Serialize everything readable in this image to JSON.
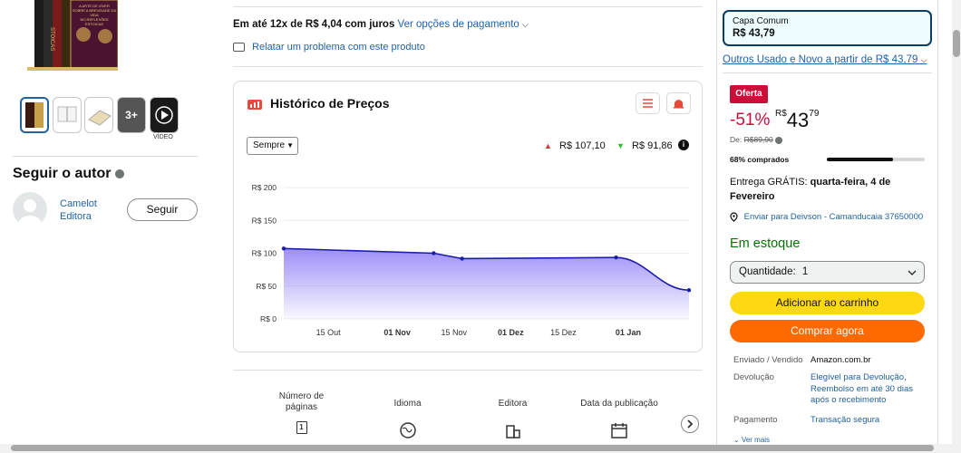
{
  "gallery": {
    "more_count": "3+",
    "video_label": "VÍDEO",
    "cover_lines": [
      "STOICAS",
      "A ARTE DE VIVER",
      "SOBRE A BREVIDADE DA VIDA",
      "NO REFLEXÕES ESTOICAS"
    ]
  },
  "author": {
    "section_title": "Seguir o autor",
    "name": "Camelot Editora",
    "follow_label": "Seguir"
  },
  "payment": {
    "installment": "Em até 12x de R$ 4,04 com juros",
    "options_link": "Ver opções de pagamento",
    "report_link": "Relatar um problema com este produto"
  },
  "price_history": {
    "title": "Histórico de Preços",
    "period_select": "Sempre",
    "max_price": "R$ 107,10",
    "min_price": "R$ 91,86",
    "accent": "#6b5cf0"
  },
  "chart_data": {
    "type": "area",
    "title": "",
    "xlabel": "",
    "ylabel": "",
    "ylim": [
      0,
      200
    ],
    "yticks": [
      "R$ 200",
      "R$ 150",
      "R$ 100",
      "R$ 50",
      "R$ 0"
    ],
    "ytick_values": [
      200,
      150,
      100,
      50,
      0
    ],
    "xticks": [
      {
        "label": "15 Out",
        "bold": false,
        "pos": 0.11
      },
      {
        "label": "01 Nov",
        "bold": true,
        "pos": 0.28
      },
      {
        "label": "15 Nov",
        "bold": false,
        "pos": 0.42
      },
      {
        "label": "01 Dez",
        "bold": true,
        "pos": 0.56
      },
      {
        "label": "15 Dez",
        "bold": false,
        "pos": 0.69
      },
      {
        "label": "01 Jan",
        "bold": true,
        "pos": 0.85
      }
    ],
    "series": [
      {
        "x": [
          0.0,
          0.37,
          0.44,
          0.82,
          1.0
        ],
        "values": [
          107.1,
          100.0,
          91.86,
          93.5,
          43.79
        ]
      }
    ],
    "grid": true
  },
  "details": {
    "items": [
      {
        "label": "Número de páginas",
        "icon": "pages-icon"
      },
      {
        "label": "Idioma",
        "icon": "globe-icon"
      },
      {
        "label": "Editora",
        "icon": "building-icon"
      },
      {
        "label": "Data da publicação",
        "icon": "calendar-icon"
      }
    ]
  },
  "buybox": {
    "format_name": "Capa Comum",
    "format_price": "R$ 43,79",
    "used_link": "Outros Usado e Novo a partir de R$ 43,79",
    "deal_badge": "Oferta",
    "discount": "-51%",
    "currency": "R$",
    "price_whole": "43",
    "price_fraction": "79",
    "list_price_label": "De:",
    "list_price": "R$89,90",
    "bought_pct_label": "68% comprados",
    "bought_pct": 68,
    "delivery_prefix": "Entrega GRÁTIS:",
    "delivery_date": "quarta-feira, 4 de Fevereiro",
    "ship_to": "Enviar para Deivson - Camanducaia 37650000",
    "stock": "Em estoque",
    "quantity_label": "Quantidade:",
    "quantity_value": "1",
    "add_to_cart": "Adicionar ao carrinho",
    "buy_now": "Comprar agora",
    "sold_by_label": "Enviado / Vendido",
    "sold_by": "Amazon.com.br",
    "return_label": "Devolução",
    "return_value": "Elegível para Devolução, Reembolso em até 30 dias após o recebimento",
    "payment_label": "Pagamento",
    "payment_value": "Transação segura",
    "see_more": "Ver mais"
  },
  "colors": {
    "link": "#2162a1",
    "deal": "#cc0c39",
    "stock": "#007600",
    "cart": "#ffd814",
    "buy": "#ff6a00"
  }
}
